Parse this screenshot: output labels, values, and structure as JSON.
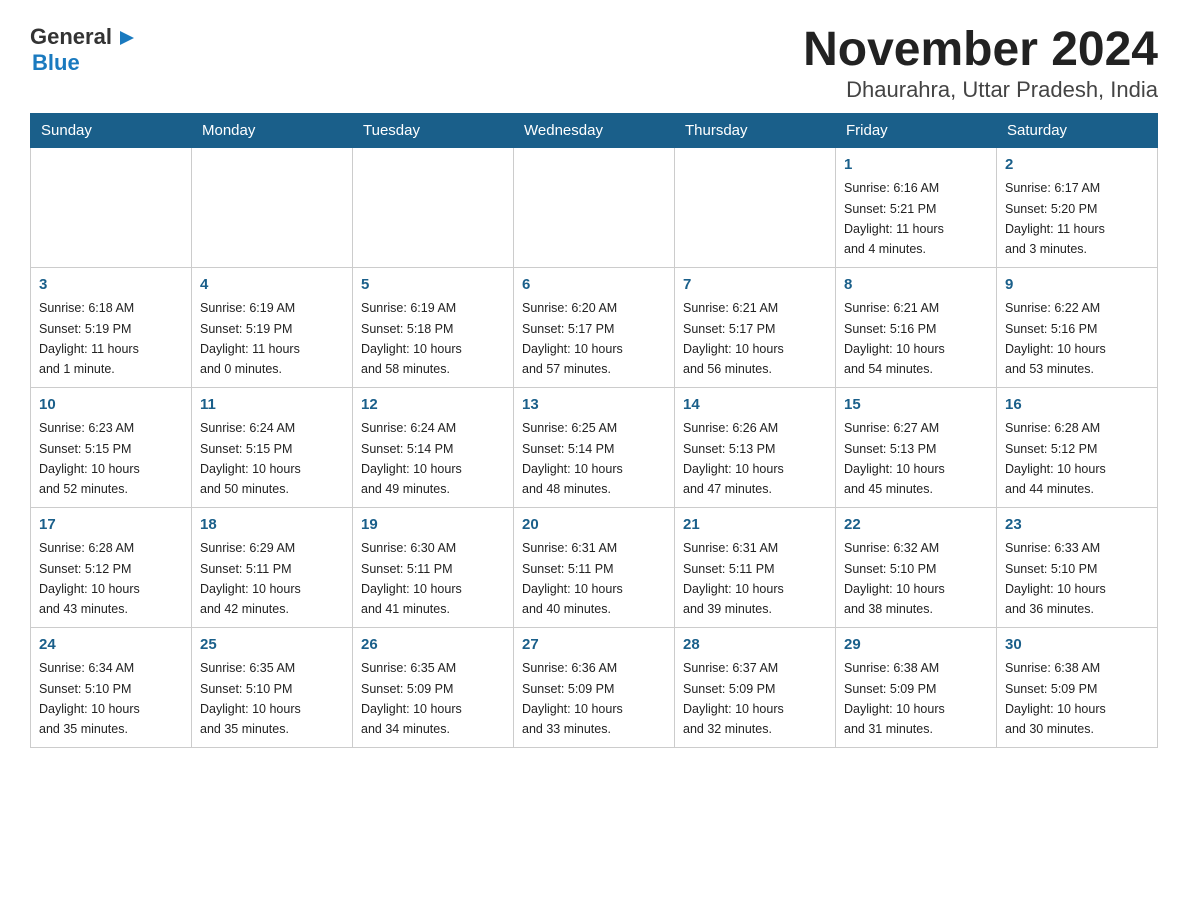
{
  "logo": {
    "general": "General",
    "blue": "Blue",
    "icon": "▶"
  },
  "title": "November 2024",
  "subtitle": "Dhaurahra, Uttar Pradesh, India",
  "weekdays": [
    "Sunday",
    "Monday",
    "Tuesday",
    "Wednesday",
    "Thursday",
    "Friday",
    "Saturday"
  ],
  "weeks": [
    [
      {
        "day": "",
        "info": ""
      },
      {
        "day": "",
        "info": ""
      },
      {
        "day": "",
        "info": ""
      },
      {
        "day": "",
        "info": ""
      },
      {
        "day": "",
        "info": ""
      },
      {
        "day": "1",
        "info": "Sunrise: 6:16 AM\nSunset: 5:21 PM\nDaylight: 11 hours\nand 4 minutes."
      },
      {
        "day": "2",
        "info": "Sunrise: 6:17 AM\nSunset: 5:20 PM\nDaylight: 11 hours\nand 3 minutes."
      }
    ],
    [
      {
        "day": "3",
        "info": "Sunrise: 6:18 AM\nSunset: 5:19 PM\nDaylight: 11 hours\nand 1 minute."
      },
      {
        "day": "4",
        "info": "Sunrise: 6:19 AM\nSunset: 5:19 PM\nDaylight: 11 hours\nand 0 minutes."
      },
      {
        "day": "5",
        "info": "Sunrise: 6:19 AM\nSunset: 5:18 PM\nDaylight: 10 hours\nand 58 minutes."
      },
      {
        "day": "6",
        "info": "Sunrise: 6:20 AM\nSunset: 5:17 PM\nDaylight: 10 hours\nand 57 minutes."
      },
      {
        "day": "7",
        "info": "Sunrise: 6:21 AM\nSunset: 5:17 PM\nDaylight: 10 hours\nand 56 minutes."
      },
      {
        "day": "8",
        "info": "Sunrise: 6:21 AM\nSunset: 5:16 PM\nDaylight: 10 hours\nand 54 minutes."
      },
      {
        "day": "9",
        "info": "Sunrise: 6:22 AM\nSunset: 5:16 PM\nDaylight: 10 hours\nand 53 minutes."
      }
    ],
    [
      {
        "day": "10",
        "info": "Sunrise: 6:23 AM\nSunset: 5:15 PM\nDaylight: 10 hours\nand 52 minutes."
      },
      {
        "day": "11",
        "info": "Sunrise: 6:24 AM\nSunset: 5:15 PM\nDaylight: 10 hours\nand 50 minutes."
      },
      {
        "day": "12",
        "info": "Sunrise: 6:24 AM\nSunset: 5:14 PM\nDaylight: 10 hours\nand 49 minutes."
      },
      {
        "day": "13",
        "info": "Sunrise: 6:25 AM\nSunset: 5:14 PM\nDaylight: 10 hours\nand 48 minutes."
      },
      {
        "day": "14",
        "info": "Sunrise: 6:26 AM\nSunset: 5:13 PM\nDaylight: 10 hours\nand 47 minutes."
      },
      {
        "day": "15",
        "info": "Sunrise: 6:27 AM\nSunset: 5:13 PM\nDaylight: 10 hours\nand 45 minutes."
      },
      {
        "day": "16",
        "info": "Sunrise: 6:28 AM\nSunset: 5:12 PM\nDaylight: 10 hours\nand 44 minutes."
      }
    ],
    [
      {
        "day": "17",
        "info": "Sunrise: 6:28 AM\nSunset: 5:12 PM\nDaylight: 10 hours\nand 43 minutes."
      },
      {
        "day": "18",
        "info": "Sunrise: 6:29 AM\nSunset: 5:11 PM\nDaylight: 10 hours\nand 42 minutes."
      },
      {
        "day": "19",
        "info": "Sunrise: 6:30 AM\nSunset: 5:11 PM\nDaylight: 10 hours\nand 41 minutes."
      },
      {
        "day": "20",
        "info": "Sunrise: 6:31 AM\nSunset: 5:11 PM\nDaylight: 10 hours\nand 40 minutes."
      },
      {
        "day": "21",
        "info": "Sunrise: 6:31 AM\nSunset: 5:11 PM\nDaylight: 10 hours\nand 39 minutes."
      },
      {
        "day": "22",
        "info": "Sunrise: 6:32 AM\nSunset: 5:10 PM\nDaylight: 10 hours\nand 38 minutes."
      },
      {
        "day": "23",
        "info": "Sunrise: 6:33 AM\nSunset: 5:10 PM\nDaylight: 10 hours\nand 36 minutes."
      }
    ],
    [
      {
        "day": "24",
        "info": "Sunrise: 6:34 AM\nSunset: 5:10 PM\nDaylight: 10 hours\nand 35 minutes."
      },
      {
        "day": "25",
        "info": "Sunrise: 6:35 AM\nSunset: 5:10 PM\nDaylight: 10 hours\nand 35 minutes."
      },
      {
        "day": "26",
        "info": "Sunrise: 6:35 AM\nSunset: 5:09 PM\nDaylight: 10 hours\nand 34 minutes."
      },
      {
        "day": "27",
        "info": "Sunrise: 6:36 AM\nSunset: 5:09 PM\nDaylight: 10 hours\nand 33 minutes."
      },
      {
        "day": "28",
        "info": "Sunrise: 6:37 AM\nSunset: 5:09 PM\nDaylight: 10 hours\nand 32 minutes."
      },
      {
        "day": "29",
        "info": "Sunrise: 6:38 AM\nSunset: 5:09 PM\nDaylight: 10 hours\nand 31 minutes."
      },
      {
        "day": "30",
        "info": "Sunrise: 6:38 AM\nSunset: 5:09 PM\nDaylight: 10 hours\nand 30 minutes."
      }
    ]
  ]
}
